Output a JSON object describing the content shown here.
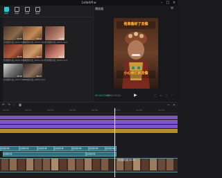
{
  "window": {
    "title": "1x0a4rfi.w"
  },
  "toolbar": {
    "items": [
      {
        "label": "媒体",
        "active": true
      },
      {
        "label": "音频",
        "active": false
      },
      {
        "label": "文本",
        "active": false
      },
      {
        "label": "贴纸",
        "active": false
      }
    ]
  },
  "media": {
    "clips": [
      {
        "name": "影视剧片段_0001.mp4",
        "duration": "00:05"
      },
      {
        "name": "影视剧片段_0002.mp4",
        "duration": "00:04"
      },
      {
        "name": "影视剧片段_0003.mp4",
        "duration": "00:06"
      },
      {
        "name": "影视剧片段_0004.mp4",
        "duration": "00:05"
      },
      {
        "name": "影视剧片段_0005.mp4",
        "duration": "00:03"
      },
      {
        "name": "影视剧片段_0006.mp4",
        "duration": "00:07"
      },
      {
        "name": "影视剧片段_0007.mp4",
        "duration": "00:05"
      },
      {
        "name": "TVB剧片段_0008.mp4",
        "duration": "00:04"
      }
    ]
  },
  "player": {
    "title": "播放器",
    "caption_top": "他准备好了去做",
    "caption_bottom": "小心我们就去做",
    "time_current": "00:00:23:16",
    "time_total": "00:01:15:01"
  },
  "timeline": {
    "ticks": [
      "00:00",
      "00:10",
      "00:20",
      "00:30",
      "00:40",
      "00:50",
      "01:00",
      "01:10"
    ],
    "subtitle_clips": [
      "连续剧字幕",
      "连续剧字幕",
      "连续剧字幕",
      "连续剧字幕",
      "连续剧字幕",
      "连续剧字幕",
      "连续剧字幕",
      "连续剧字幕",
      "连续剧字幕"
    ],
    "video_label": "影视剧片段 00:05"
  },
  "colors": {
    "accent": "#30c5d3",
    "audio_purple": "#7c55c8",
    "audio_gold": "#b98d23"
  }
}
